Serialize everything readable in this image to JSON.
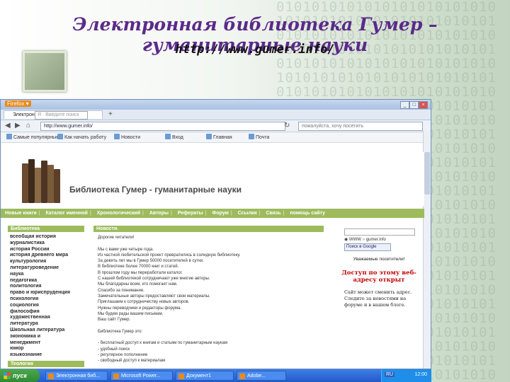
{
  "slide": {
    "title": "Электронная библиотека Гумер – гуманитарные науки",
    "url": "http://www.gumer.info/"
  },
  "browser": {
    "title_badge": "Firefox ▾",
    "tab_label": "Электронная библиотека Гу...",
    "tab_plus": "+",
    "address": "http://www.gumer.info/",
    "search_placeholder": "пожалуйста, хочу посетить",
    "bookmarks": [
      "Самые популярные",
      "Как начать работу",
      "Новости",
      "Вход",
      "Главная",
      "Почта"
    ],
    "yandex_search_placeholder": "Я · Введите поиск"
  },
  "site": {
    "title": "Библиотека Гумер - гуманитарные науки",
    "menu": [
      "Новые книги",
      "Каталог именной",
      "Хронологический",
      "Авторы",
      "Рефераты",
      "Форум",
      "Ссылки",
      "Связь",
      "помощь сайту"
    ],
    "left_header": "Библиотека",
    "left_items": [
      "всеобщая история",
      "журналистика",
      "история России",
      "история древнего мира",
      "культурология",
      "литературоведение",
      "наука",
      "педагогика",
      "политология",
      "право и юриспруденция",
      "психология",
      "социология",
      "философия",
      "художественная",
      "литература",
      "Школьная литература",
      "экономика и",
      "менеджмент",
      "юмор",
      "языкознание"
    ],
    "left_header2": "Теология",
    "news_header": "Новости.",
    "news_lines": [
      "Дорогие читатели!",
      "",
      "Мы с вами уже четыре года.",
      "Из частной любительской проект превратились в солидную библиотеку.",
      "За девять лет мы в Гумер 50000 посетителей в сутки.",
      "В библиотеке более 70000 книг и статей.",
      "В прошлом году мы переработали каталог.",
      "С нашей библиотекой сотрудничают уже многие авторы.",
      "Мы благодарны всем, кто помогает нам.",
      "Спасибо за понимание.",
      "Замечательные авторы предоставляют свои материалы.",
      "Приглашаем к сотрудничеству новых авторов.",
      "Нужны переводчики и редакторы форума.",
      "Мы будем рады вашим письмам.",
      "Ваш сайт Гумер.",
      "",
      "Библиотека Гумер это:",
      "",
      "- бесплатный доступ к книгам и статьям по гуманитарным наукам",
      "- удобный поиск",
      "- регулярное пополнение",
      "- свободный доступ к материалам"
    ],
    "right_radio": "◉ WWW ○ gumer.info",
    "google_button": "Поиск в Google",
    "right_notice": "Уважаемые посетители!",
    "right_red": "Доступ по этому веб-адресу открыт",
    "right_text": "Сайт может сменить адрес. Следите за новостями на форуме и в нашем блоге."
  },
  "taskbar": {
    "start_label": "пуск",
    "tasks": [
      "Электронная биб...",
      "Microsoft Power...",
      "Документ1",
      "Adobe..."
    ],
    "lang": "RU",
    "clock": "12:00"
  }
}
